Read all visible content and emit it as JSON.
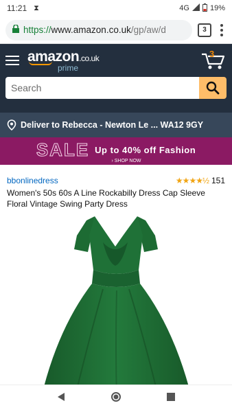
{
  "status_bar": {
    "time": "11:21",
    "network": "4G",
    "battery": "19%"
  },
  "browser": {
    "url_scheme": "https://",
    "url_host": "www.amazon.co.uk",
    "url_path": "/gp/aw/d",
    "tab_count": "3"
  },
  "header": {
    "logo_word": "amazon",
    "logo_suffix": ".co.uk",
    "logo_sub": "prime",
    "cart_count": "3",
    "search_placeholder": "Search"
  },
  "deliver": {
    "text": "Deliver to Rebecca - Newton Le ... WA12 9GY"
  },
  "banner": {
    "sale": "SALE",
    "text": "Up to 40% off Fashion",
    "cta": "› SHOP NOW"
  },
  "product": {
    "brand": "bbonlinedress",
    "rating_stars": "★★★★½",
    "rating_count": "151",
    "title": "Women's 50s 60s A Line Rockabilly Dress Cap Sleeve Floral Vintage Swing Party Dress",
    "image_count": 7,
    "active_image": 0
  },
  "colors": {
    "amazon_header": "#232f3e",
    "deliver_bar": "#37475a",
    "search_button": "#febd69",
    "banner": "#8b1a63",
    "link": "#0066c0",
    "dress": "#1f6b34"
  }
}
